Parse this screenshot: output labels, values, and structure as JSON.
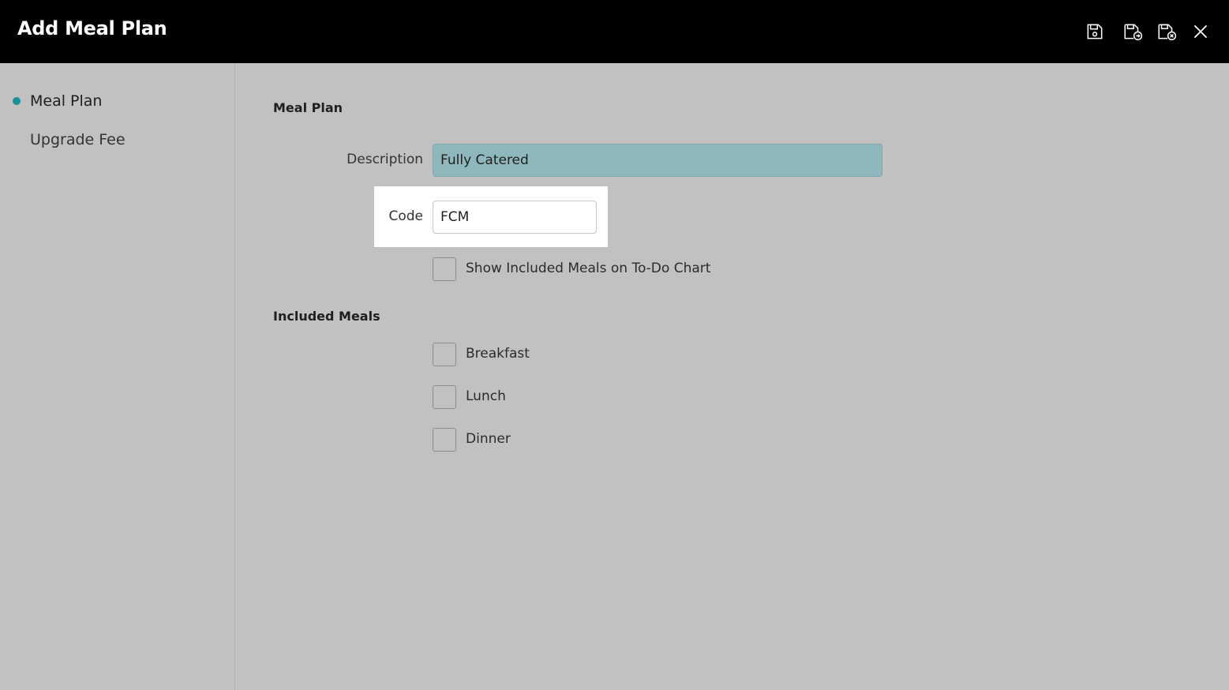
{
  "header": {
    "title": "Add Meal Plan",
    "icons": [
      "save-icon",
      "save-and-new-icon",
      "save-and-close-icon",
      "close-icon"
    ]
  },
  "sidebar": {
    "items": [
      {
        "label": "Meal Plan",
        "active": true
      },
      {
        "label": "Upgrade Fee",
        "active": false
      }
    ]
  },
  "form": {
    "meal_plan_section": "Meal Plan",
    "description_label": "Description",
    "description_value": "Fully Catered",
    "code_label": "Code",
    "code_value": "FCM",
    "show_meals_label": "Show Included Meals on To-Do Chart",
    "show_meals_checked": false,
    "included_meals_section": "Included Meals",
    "meals": [
      {
        "label": "Breakfast",
        "checked": false
      },
      {
        "label": "Lunch",
        "checked": false
      },
      {
        "label": "Dinner",
        "checked": false
      }
    ]
  },
  "colors": {
    "header_bg": "#000000",
    "accent": "#1a8f99",
    "description_field_bg": "#8fb8bd",
    "page_bg": "#c1c1c1"
  }
}
